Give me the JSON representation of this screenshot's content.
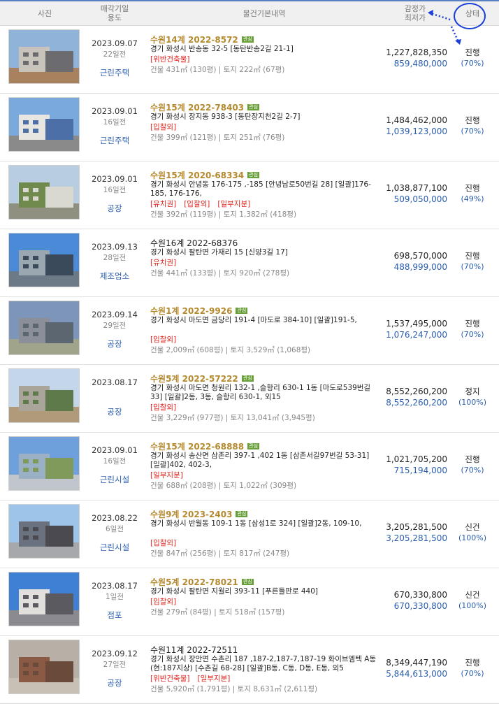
{
  "header": {
    "photo": "사진",
    "date": [
      "매각기일",
      "용도"
    ],
    "info": "물건기본내역",
    "price": [
      "감정가",
      "최저가"
    ],
    "status": "상태"
  },
  "rows": [
    {
      "date": "2023.09.07",
      "ago": "22일전",
      "usage": "근린주택",
      "case": "수원14계 2022-8572",
      "attention": true,
      "badge": "관심",
      "address": "경기 화성시 반송동 32-5 [동탄반송2길 21-1]",
      "tags": [
        "[위반건축물]"
      ],
      "size": "건물 431㎡ (130평)  |  토지 222㎡ (67평)",
      "appraisal": "1,227,828,350",
      "minimum": "859,480,000",
      "status": "진행",
      "pct": "(70%)"
    },
    {
      "date": "2023.09.01",
      "ago": "16일전",
      "usage": "근린주택",
      "case": "수원15계 2022-78403",
      "attention": true,
      "badge": "관심",
      "address": "경기 화성시 장지동 938-3 [동탄장지천2길 2-7]",
      "tags": [
        "[입찰외]"
      ],
      "size": "건물 399㎡ (121평)  |  토지 251㎡ (76평)",
      "appraisal": "1,484,462,000",
      "minimum": "1,039,123,000",
      "status": "진행",
      "pct": "(70%)"
    },
    {
      "date": "2023.09.01",
      "ago": "16일전",
      "usage": "공장",
      "case": "수원15계 2020-68334",
      "attention": true,
      "badge": "관심",
      "address": "경기 화성시 안녕동 176-175 ,-185 [안녕남로50번길 28]  [일괄]176-185, 176-176,",
      "tags": [
        "[유치권]",
        "[입찰외]",
        "[일부지분]"
      ],
      "size": "건물 392㎡ (119평)  |  토지 1,382㎡ (418평)",
      "appraisal": "1,038,877,100",
      "minimum": "509,050,000",
      "status": "진행",
      "pct": "(49%)"
    },
    {
      "date": "2023.09.13",
      "ago": "28일전",
      "usage": "제조업소",
      "case": "수원16계 2022-68376",
      "attention": false,
      "badge": "",
      "address": "경기 화성시 팔탄면 가재리 15 [신양3길 17]",
      "tags": [
        "[유치권]"
      ],
      "size": "건물 441㎡ (133평)  |  토지 920㎡ (278평)",
      "appraisal": "698,570,000",
      "minimum": "488,999,000",
      "status": "진행",
      "pct": "(70%)"
    },
    {
      "date": "2023.09.14",
      "ago": "29일전",
      "usage": "공장",
      "case": "수원1계 2022-9926",
      "attention": true,
      "badge": "관심",
      "address": "경기 화성시 마도면 금당리 191-4 [마도로 384-10]  [일괄]191-5,",
      "tags": [
        "[입찰외]"
      ],
      "size": "건물 2,009㎡ (608평)  |  토지 3,529㎡ (1,068평)",
      "appraisal": "1,537,495,000",
      "minimum": "1,076,247,000",
      "status": "진행",
      "pct": "(70%)"
    },
    {
      "date": "2023.08.17",
      "ago": "",
      "usage": "공장",
      "case": "수원5계 2022-57222",
      "attention": true,
      "badge": "관심",
      "address": "경기 화성시 마도면 청원리 132-1 ,슬항리 630-1 1동 [마도로539번길 33]  [일괄]2동, 3동, 슬항리 630-1, 외15",
      "tags": [
        "[입찰외]"
      ],
      "size": "건물 3,229㎡ (977평)  |  토지 13,041㎡ (3,945평)",
      "appraisal": "8,552,260,200",
      "minimum": "8,552,260,200",
      "status": "정지",
      "pct": "(100%)"
    },
    {
      "date": "2023.09.01",
      "ago": "16일전",
      "usage": "근린시설",
      "case": "수원15계 2022-68888",
      "attention": true,
      "badge": "관심",
      "address": "경기 화성시 송산면 삼존리 397-1 ,402 1동 [삼존서길97번길 53-31]  [일괄]402, 402-3,",
      "tags": [
        "[일부지분]"
      ],
      "size": "건물 688㎡ (208평)  |  토지 1,022㎡ (309평)",
      "appraisal": "1,021,705,200",
      "minimum": "715,194,000",
      "status": "진행",
      "pct": "(70%)"
    },
    {
      "date": "2023.08.22",
      "ago": "6일전",
      "usage": "근린시설",
      "case": "수원9계 2023-2403",
      "attention": true,
      "badge": "관심",
      "address": "경기 화성시 반월동 109-1 1동 [삼성1로 324]  [일괄]2동, 109-10,",
      "tags": [
        "[입찰외]"
      ],
      "size": "건물 847㎡ (256평)  |  토지 817㎡ (247평)",
      "appraisal": "3,205,281,500",
      "minimum": "3,205,281,500",
      "status": "신건",
      "pct": "(100%)"
    },
    {
      "date": "2023.08.17",
      "ago": "1일전",
      "usage": "점포",
      "case": "수원5계 2022-78021",
      "attention": true,
      "badge": "관심",
      "address": "경기 화성시 팔탄면 지월리 393-11 [푸른들판로 440]",
      "tags": [
        "[입찰외]"
      ],
      "size": "건물 279㎡ (84평)  |  토지 518㎡ (157평)",
      "appraisal": "670,330,800",
      "minimum": "670,330,800",
      "status": "신건",
      "pct": "(100%)"
    },
    {
      "date": "2023.09.12",
      "ago": "27일전",
      "usage": "공장",
      "case": "수원11계 2022-72511",
      "attention": false,
      "badge": "",
      "address": "경기 화성시 장안면 수촌리 187 ,187-2,187-7,187-19 화이브엠텍 A동(현:187지상) [수촌길 68-28]  [일괄]B동, C동, D동, E동, 외5",
      "tags": [
        "[위반건축물]",
        "[일부지분]"
      ],
      "size": "건물 5,920㎡ (1,791평)  |  토지 8,631㎡ (2,611평)",
      "appraisal": "8,349,447,190",
      "minimum": "5,844,613,000",
      "status": "진행",
      "pct": "(70%)"
    }
  ],
  "colors": {
    "accent": "#2a5db0",
    "title": "#b58a2e",
    "warn": "#e0201a",
    "badge": "#6aa03a",
    "annot": "#1a3fd6"
  }
}
